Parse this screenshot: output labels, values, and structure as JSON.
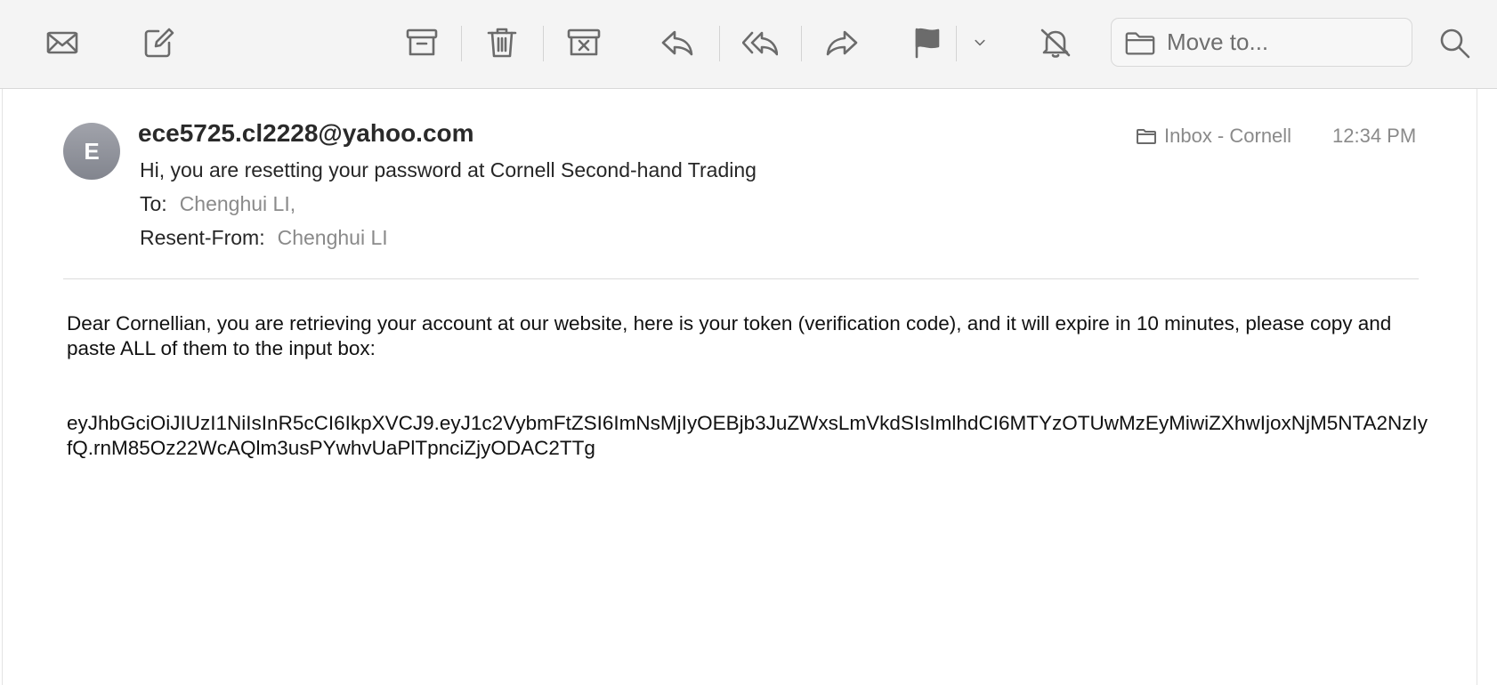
{
  "toolbar": {
    "icons": [
      "mail-icon",
      "compose-icon",
      "archive-icon",
      "trash-icon",
      "junk-icon",
      "reply-icon",
      "reply-all-icon",
      "forward-icon",
      "flag-icon",
      "chevron-down-icon",
      "mute-bell-icon",
      "search-icon"
    ],
    "move_to_label": "Move to..."
  },
  "message": {
    "avatar_initial": "E",
    "sender": "ece5725.cl2228@yahoo.com",
    "subject": "Hi, you are resetting your password at Cornell Second-hand Trading",
    "to_label": "To:",
    "to_value": "Chenghui LI,",
    "resent_from_label": "Resent-From:",
    "resent_from_value": "Chenghui LI",
    "mailbox": "Inbox - Cornell",
    "time": "12:34 PM",
    "body": "Dear Cornellian, you are retrieving your account at our website, here is your token (verification code), and it will expire in 10 minutes, please copy and paste ALL of them to the input box:",
    "token": "eyJhbGciOiJIUzI1NiIsInR5cCI6IkpXVCJ9.eyJ1c2VybmFtZSI6ImNsMjIyOEBjb3JuZWxsLmVkdSIsImlhdCI6MTYzOTUwMzEyMiwiZXhwIjoxNjM5NTA2NzIyfQ.rnM85Oz22WcAQlm3usPYwhvUaPlTpnciZjyODAC2TTg"
  },
  "colors": {
    "toolbar_bg": "#f4f4f4",
    "icon_gray": "#6b6b6b",
    "secondary_text": "#8a8a8a",
    "avatar_bg": "#8f929a"
  }
}
